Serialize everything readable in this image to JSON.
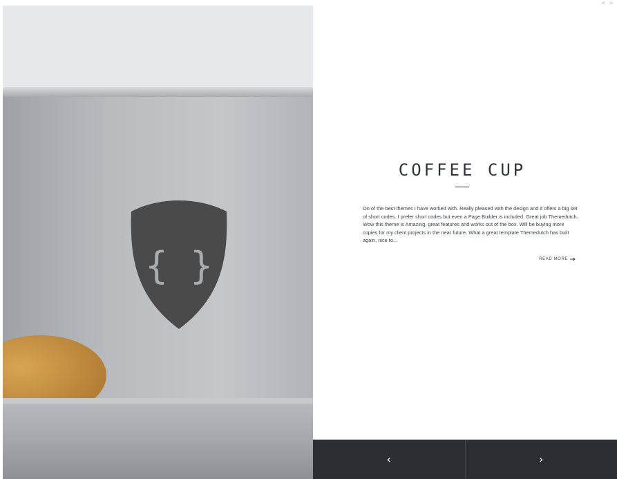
{
  "corner_mark": "^ ^",
  "product": {
    "title": "COFFEE CUP",
    "description": "On of the best themes I have worked with. Really pleased with the design and it offers a big set of short codes. I prefer short codes but even a Page Builder is included. Great job Themedutch. Wow this theme is Amazing, great features and works out of the box. Will be buying more copies for my client projects in the near future. What a great template Themedutch has built again, nice to...",
    "read_more_label": "READ MORE"
  },
  "logo": {
    "glyph": "{ }"
  },
  "icons": {
    "read_more": "arrow-right-icon",
    "prev": "chevron-left-icon",
    "next": "chevron-right-icon"
  },
  "nav": {
    "prev_glyph": "‹",
    "next_glyph": "›"
  },
  "colors": {
    "text_dark": "#2f3338",
    "nav_bg": "#2b2f34",
    "cup_grey": "#b2b6ba",
    "shield": "#4a4a4b",
    "cookie": "#c89442"
  }
}
